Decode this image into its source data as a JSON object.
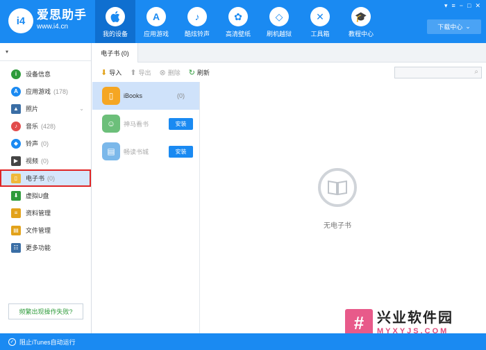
{
  "brand": {
    "logo_text": "i4",
    "name": "爱思助手",
    "url": "www.i4.cn"
  },
  "nav": [
    {
      "label": "我的设备",
      "icon": "apple-icon",
      "glyph": "",
      "active": true
    },
    {
      "label": "应用游戏",
      "icon": "app-store-icon",
      "glyph": "A"
    },
    {
      "label": "酷炫铃声",
      "icon": "bell-icon",
      "glyph": "♪"
    },
    {
      "label": "高清壁纸",
      "icon": "flower-icon",
      "glyph": "✿"
    },
    {
      "label": "刷机越狱",
      "icon": "dropbox-icon",
      "glyph": "◇"
    },
    {
      "label": "工具箱",
      "icon": "tools-icon",
      "glyph": "✕"
    },
    {
      "label": "教程中心",
      "icon": "graduation-cap-icon",
      "glyph": "🎓"
    }
  ],
  "window_controls": [
    "▾",
    "≡",
    "−",
    "□",
    "✕"
  ],
  "download_center": {
    "label": "下载中心",
    "icon": "chevron-down-icon"
  },
  "sidebar": {
    "device_selector": "▾",
    "items": [
      {
        "label": "设备信息",
        "count": "",
        "icon": "info-icon",
        "color": "#2e9b3b",
        "glyph": "i"
      },
      {
        "label": "应用游戏",
        "count": "(178)",
        "icon": "app-store-icon",
        "color": "#1a8af2",
        "glyph": "A"
      },
      {
        "label": "照片",
        "count": "",
        "icon": "photo-icon",
        "color": "#3a6ea5",
        "glyph": "▲",
        "chevron": "⌄"
      },
      {
        "label": "音乐",
        "count": "(428)",
        "icon": "music-icon",
        "color": "#e24c4c",
        "glyph": "♪"
      },
      {
        "label": "铃声",
        "count": "(0)",
        "icon": "bell-icon",
        "color": "#1a8af2",
        "glyph": "◆"
      },
      {
        "label": "视频",
        "count": "(0)",
        "icon": "video-icon",
        "color": "#444",
        "glyph": "▶"
      },
      {
        "label": "电子书",
        "count": "(0)",
        "icon": "book-icon",
        "color": "#f0b83a",
        "glyph": "▯",
        "active": true
      },
      {
        "label": "虚拟U盘",
        "count": "",
        "icon": "usb-icon",
        "color": "#2e9b3b",
        "glyph": "⬇"
      },
      {
        "label": "资料管理",
        "count": "",
        "icon": "contacts-icon",
        "color": "#e2a21a",
        "glyph": "≡"
      },
      {
        "label": "文件管理",
        "count": "",
        "icon": "folder-icon",
        "color": "#e2a21a",
        "glyph": "▤"
      },
      {
        "label": "更多功能",
        "count": "",
        "icon": "more-icon",
        "color": "#3a6ea5",
        "glyph": "☷"
      }
    ],
    "help_button": "频繁出现操作失败?"
  },
  "footer": {
    "label": "阻止iTunes自动运行",
    "check": "✓"
  },
  "tab": {
    "label": "电子书 (0)"
  },
  "toolbar": {
    "import": "导入",
    "export": "导出",
    "delete": "删除",
    "refresh": "刷新"
  },
  "search": {
    "placeholder": ""
  },
  "apps": [
    {
      "name": "iBooks",
      "count": "(0)",
      "color": "#f5a623",
      "icon": "ibooks-icon",
      "glyph": "▯",
      "active": true
    },
    {
      "name": "神马看书",
      "install": "安装",
      "color": "#6cbf7a",
      "icon": "shenma-reader-icon",
      "glyph": "☺"
    },
    {
      "name": "畅读书城",
      "install": "安装",
      "color": "#7bb8ea",
      "icon": "changdu-reader-icon",
      "glyph": "▤"
    }
  ],
  "empty_state": {
    "text": "无电子书"
  },
  "watermark": {
    "mark": "#",
    "title": "兴业软件园",
    "sub": "MYXYJS.COM"
  }
}
